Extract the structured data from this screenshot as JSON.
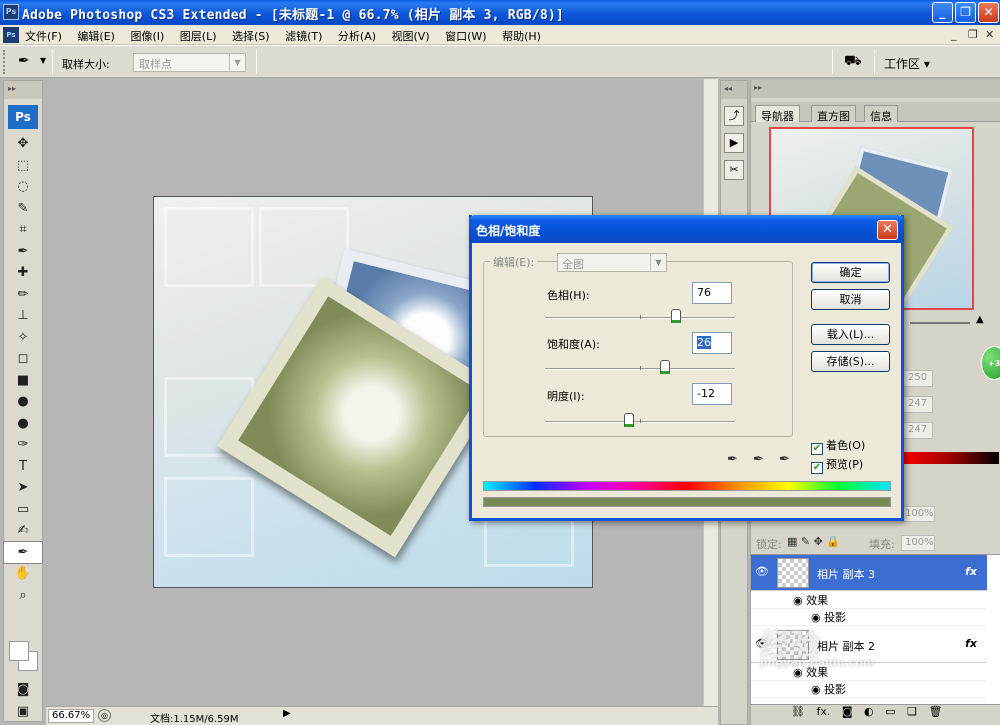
{
  "window": {
    "app_icon": "Ps",
    "title": "Adobe Photoshop CS3 Extended - [未标题-1 @ 66.7% (相片 副本 3, RGB/8)]",
    "buttons": [
      "_",
      "❐",
      "✕"
    ]
  },
  "menu": {
    "items": [
      "文件(F)",
      "编辑(E)",
      "图像(I)",
      "图层(L)",
      "选择(S)",
      "滤镜(T)",
      "分析(A)",
      "视图(V)",
      "窗口(W)",
      "帮助(H)"
    ],
    "mdi": [
      "_",
      "❐",
      "✕"
    ]
  },
  "options": {
    "sample_size_label": "取样大小:",
    "sample_size_value": "取样点",
    "workspace_label": "工作区 ▾"
  },
  "toolbox": {
    "logo": "Ps",
    "tools": [
      "✥",
      "⬚",
      "◌",
      "✎",
      "⌗",
      "✒",
      "✚",
      "✏",
      "⊥",
      "✧",
      "◻",
      "■",
      "●",
      "●",
      "✑",
      "T",
      "➤",
      "▭",
      "✍",
      "✒",
      "✋",
      "⌕"
    ]
  },
  "status": {
    "zoom": "66.67%",
    "doc_size": "文档:1.15M/6.59M"
  },
  "panels": {
    "tabs": [
      "导航器",
      "直方图",
      "信息"
    ],
    "color_values": [
      "250",
      "247",
      "247"
    ],
    "opacity_value": "100%",
    "lock_label": "锁定:",
    "fill_label": "填充:",
    "fill_value": "100%",
    "layers": [
      {
        "name": "相片 副本 3",
        "fx": "fx",
        "effects_label": "效果",
        "effect": "投影"
      },
      {
        "name": "相片 副本 2",
        "fx": "fx",
        "effects_label": "效果",
        "effect": "投影"
      }
    ]
  },
  "dialog": {
    "title": "色相/饱和度",
    "edit_label": "编辑(E):",
    "edit_value": "全图",
    "hue_label": "色相(H):",
    "hue_value": "76",
    "hue_pos": 0.69,
    "saturation_label": "饱和度(A):",
    "saturation_value": "26",
    "saturation_pos": 0.63,
    "lightness_label": "明度(I):",
    "lightness_value": "-12",
    "lightness_pos": 0.44,
    "ok": "确定",
    "cancel": "取消",
    "load": "载入(L)...",
    "save": "存储(S)...",
    "colorize_label": "着色(O)",
    "preview_label": "预览(P)",
    "colorize_checked": true,
    "preview_checked": true
  },
  "watermark": {
    "text": "经验",
    "url": "jingyan.baidu.com"
  }
}
